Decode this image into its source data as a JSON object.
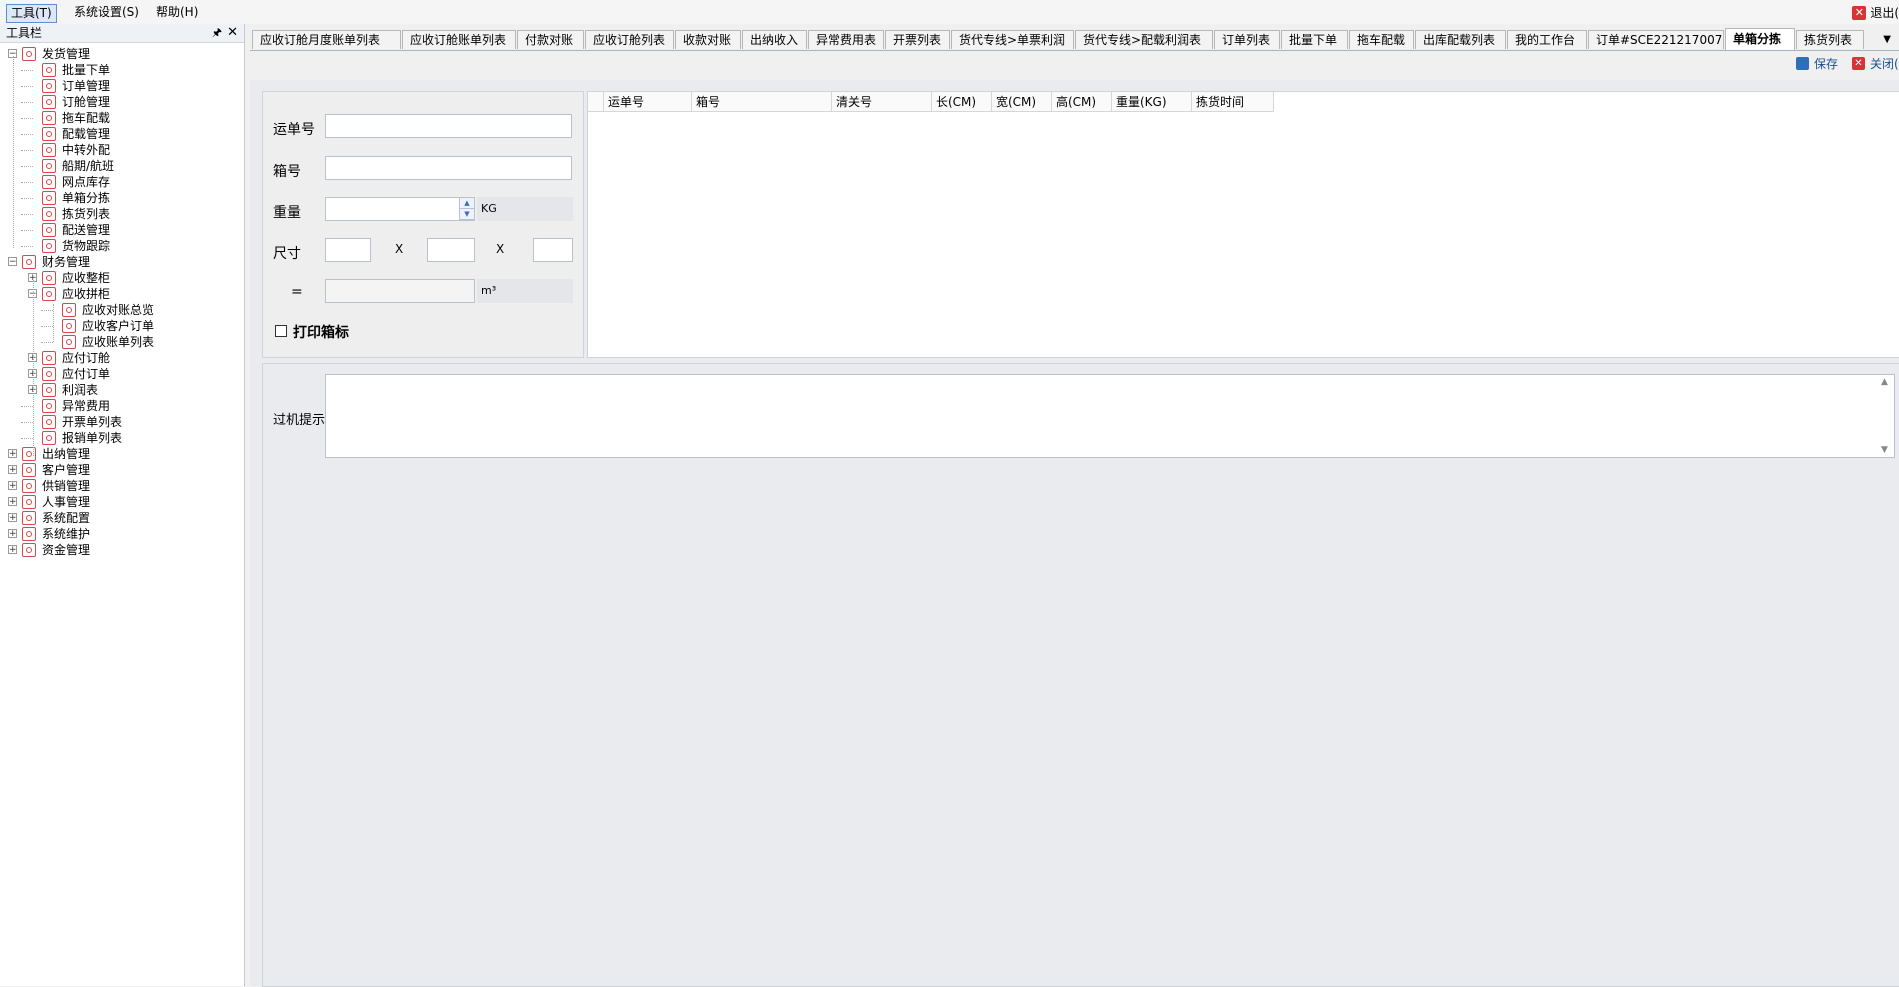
{
  "menu": {
    "items": [
      {
        "label": "工具(T)",
        "active": true
      },
      {
        "label": "系统设置(S)",
        "active": false
      },
      {
        "label": "帮助(H)",
        "active": false
      }
    ],
    "exit_label": "退出("
  },
  "sidebar": {
    "title": "工具栏",
    "pin_icon": "pin-icon",
    "close_icon": "close-icon",
    "tree": [
      {
        "label": "发货管理",
        "level": 0,
        "expand": "−"
      },
      {
        "label": "批量下单",
        "level": 1
      },
      {
        "label": "订单管理",
        "level": 1
      },
      {
        "label": "订舱管理",
        "level": 1
      },
      {
        "label": "拖车配载",
        "level": 1
      },
      {
        "label": "配载管理",
        "level": 1
      },
      {
        "label": "中转外配",
        "level": 1
      },
      {
        "label": "船期/航班",
        "level": 1
      },
      {
        "label": "网点库存",
        "level": 1
      },
      {
        "label": "单箱分拣",
        "level": 1
      },
      {
        "label": "拣货列表",
        "level": 1
      },
      {
        "label": "配送管理",
        "level": 1
      },
      {
        "label": "货物跟踪",
        "level": 1
      },
      {
        "label": "财务管理",
        "level": 0,
        "expand": "−"
      },
      {
        "label": "应收整柜",
        "level": 1,
        "expand": "+"
      },
      {
        "label": "应收拼柜",
        "level": 1,
        "expand": "−"
      },
      {
        "label": "应收对账总览",
        "level": 2
      },
      {
        "label": "应收客户订单",
        "level": 2
      },
      {
        "label": "应收账单列表",
        "level": 2
      },
      {
        "label": "应付订舱",
        "level": 1,
        "expand": "+"
      },
      {
        "label": "应付订单",
        "level": 1,
        "expand": "+"
      },
      {
        "label": "利润表",
        "level": 1,
        "expand": "+"
      },
      {
        "label": "异常费用",
        "level": 1
      },
      {
        "label": "开票单列表",
        "level": 1
      },
      {
        "label": "报销单列表",
        "level": 1
      },
      {
        "label": "出纳管理",
        "level": 0,
        "expand": "+"
      },
      {
        "label": "客户管理",
        "level": 0,
        "expand": "+"
      },
      {
        "label": "供销管理",
        "level": 0,
        "expand": "+"
      },
      {
        "label": "人事管理",
        "level": 0,
        "expand": "+"
      },
      {
        "label": "系统配置",
        "level": 0,
        "expand": "+"
      },
      {
        "label": "系统维护",
        "level": 0,
        "expand": "+"
      },
      {
        "label": "资金管理",
        "level": 0,
        "expand": "+"
      }
    ]
  },
  "tabs": [
    {
      "label": "应收订舱月度账单列表"
    },
    {
      "label": "应收订舱账单列表"
    },
    {
      "label": "付款对账"
    },
    {
      "label": "应收订舱列表"
    },
    {
      "label": "收款对账"
    },
    {
      "label": "出纳收入"
    },
    {
      "label": "异常费用表"
    },
    {
      "label": "开票列表"
    },
    {
      "label": "货代专线>单票利润"
    },
    {
      "label": "货代专线>配载利润表"
    },
    {
      "label": "订单列表"
    },
    {
      "label": "批量下单"
    },
    {
      "label": "拖车配载"
    },
    {
      "label": "出库配载列表"
    },
    {
      "label": "我的工作台"
    },
    {
      "label": "订单#SCE221217007"
    },
    {
      "label": "单箱分拣",
      "active": true
    },
    {
      "label": "拣货列表"
    }
  ],
  "toolbar": {
    "save_label": "保存",
    "close_label": "关闭("
  },
  "form": {
    "waybill_label": "运单号",
    "box_label": "箱号",
    "weight_label": "重量",
    "weight_unit": "KG",
    "size_label": "尺寸",
    "x1": "X",
    "x2": "X",
    "eq_label": "=",
    "volume_unit": "m³",
    "print_label": "打印箱标"
  },
  "grid": {
    "columns": [
      "运单号",
      "箱号",
      "清关号",
      "长(CM)",
      "宽(CM)",
      "高(CM)",
      "重量(KG)",
      "拣货时间"
    ]
  },
  "hint": {
    "label": "过机提示"
  }
}
